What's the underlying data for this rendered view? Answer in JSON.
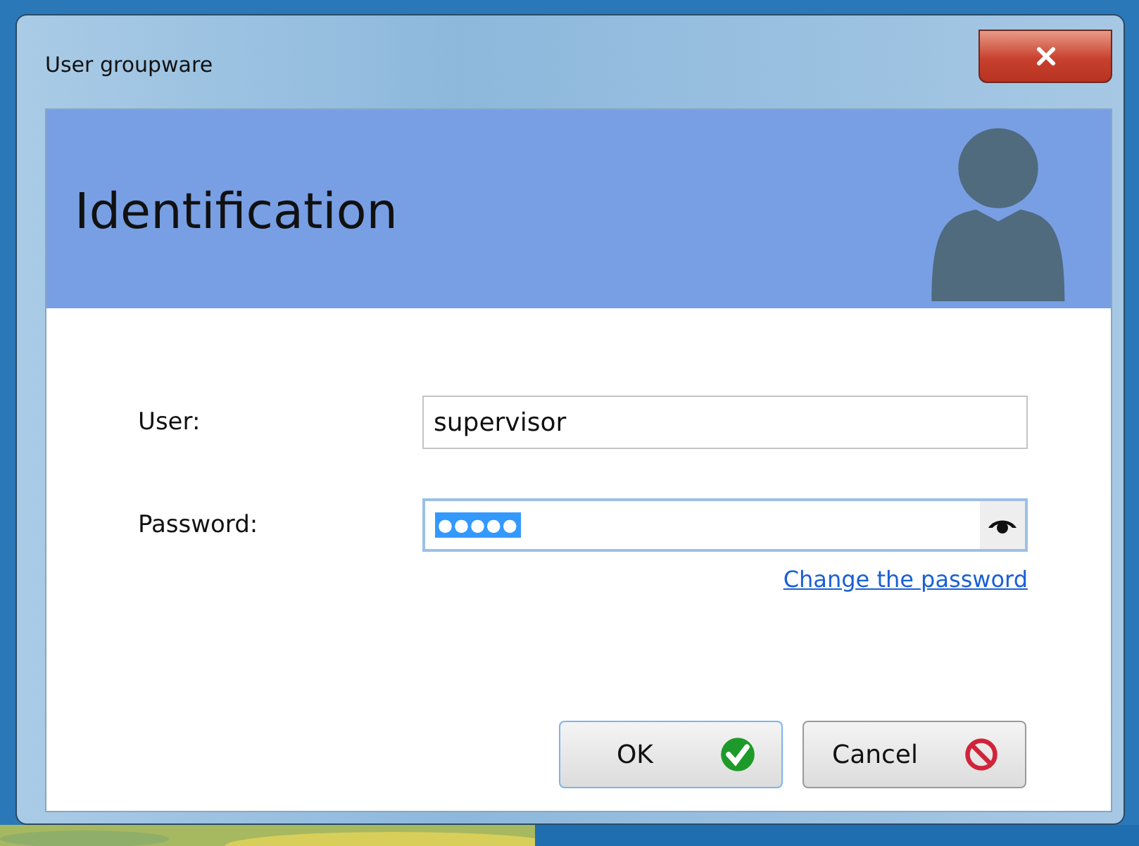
{
  "window": {
    "title": "User groupware"
  },
  "header": {
    "title": "Identification"
  },
  "fields": [
    {
      "label": "User:",
      "value": "supervisor",
      "kind": "text",
      "focused": false,
      "highlighted": false
    },
    {
      "label": "Password:",
      "value": "●●●●●",
      "kind": "password",
      "focused": true,
      "highlighted": true
    }
  ],
  "link": "Change the password",
  "buttons": [
    {
      "label": "OK",
      "kind": "ok",
      "focused": true
    },
    {
      "label": "Cancel",
      "kind": "cancel",
      "focused": false
    }
  ]
}
